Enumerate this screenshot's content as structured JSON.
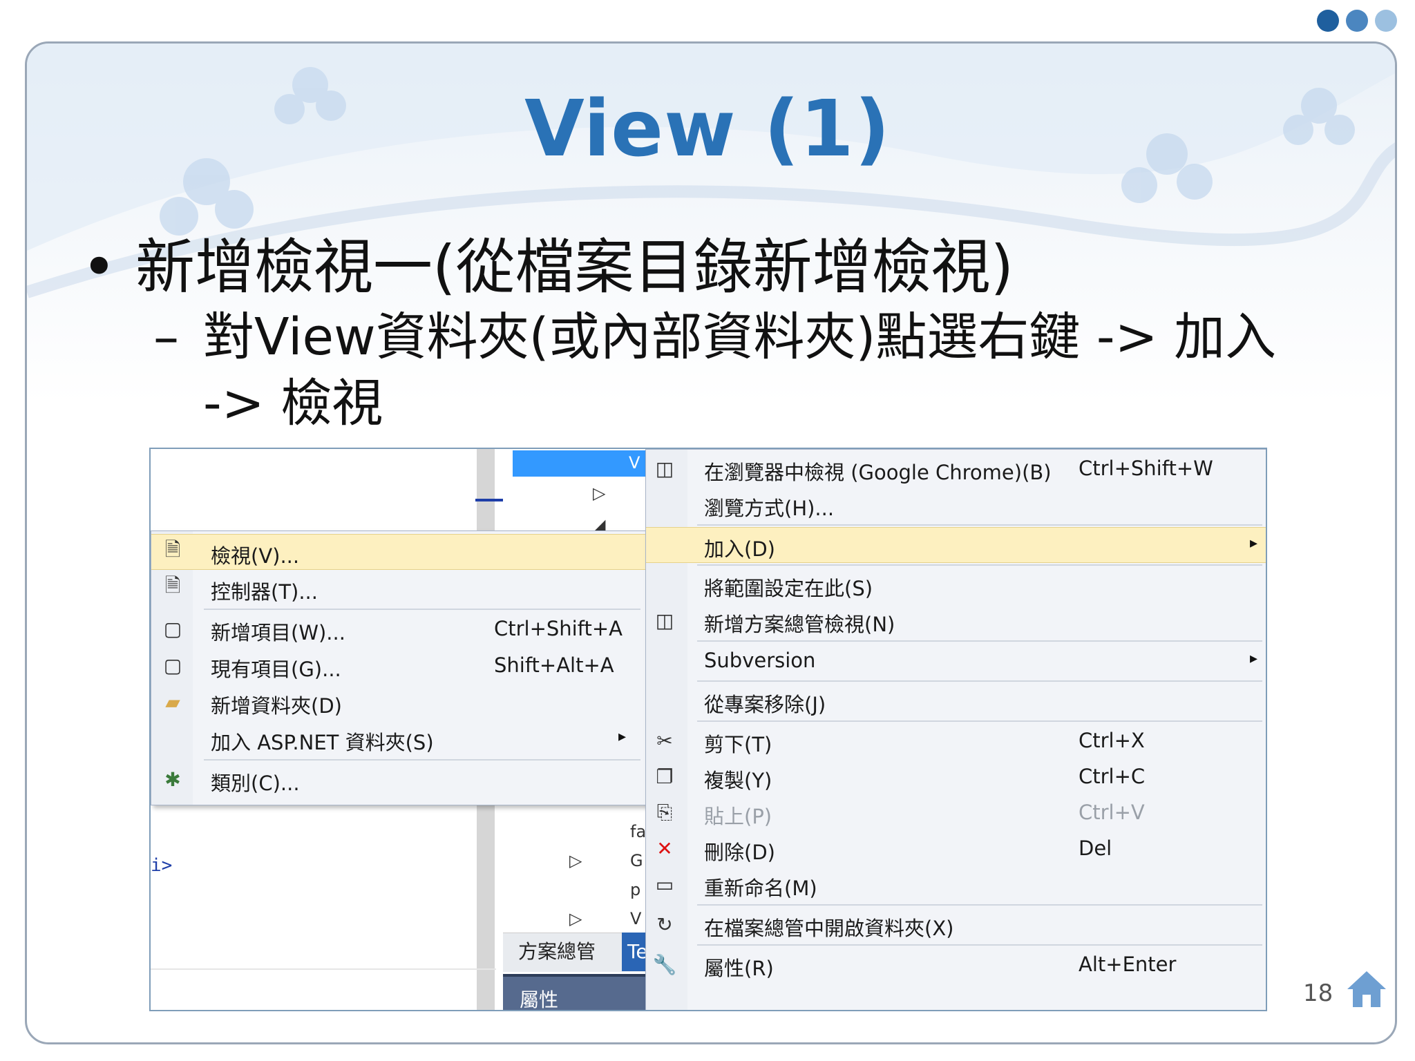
{
  "slide": {
    "title": "View (1)",
    "bullet1": {
      "marker": "•",
      "text": "新增檢視一(從檔案目錄新增檢視)"
    },
    "bullet2": {
      "marker": "–",
      "line1": "對View資料夾(或內部資料夾)點選右鍵 -> 加入",
      "line2": "-> 檢視"
    },
    "page_number": "18",
    "colors": {
      "title": "#2a72b6",
      "dot1": "#1f5f9e",
      "dot2": "#4b86c0",
      "dot3": "#9cc0e0",
      "highlight": "#fdf0c0"
    }
  },
  "screenshot": {
    "code_text": "i>",
    "solution_tab": "方案總管",
    "team_tab": "Te",
    "properties_label": "屬性",
    "tree_items": [
      "V",
      "fa",
      "G",
      "p",
      "V"
    ],
    "left_menu": [
      {
        "label": "檢視(V)...",
        "shortcut": "",
        "icon": "view-icon",
        "highlighted": true
      },
      {
        "label": "控制器(T)...",
        "shortcut": "",
        "icon": "controller-icon"
      },
      {
        "label": "新增項目(W)...",
        "shortcut": "Ctrl+Shift+A",
        "icon": "new-item-icon"
      },
      {
        "label": "現有項目(G)...",
        "shortcut": "Shift+Alt+A",
        "icon": "existing-item-icon"
      },
      {
        "label": "新增資料夾(D)",
        "shortcut": "",
        "icon": "new-folder-icon"
      },
      {
        "label": "加入 ASP.NET 資料夾(S)",
        "shortcut": "",
        "icon": "",
        "submenu": "▸"
      },
      {
        "label": "類別(C)...",
        "shortcut": "",
        "icon": "class-icon"
      }
    ],
    "right_menu": [
      {
        "label": "在瀏覽器中檢視 (Google Chrome)(B)",
        "shortcut": "Ctrl+Shift+W",
        "icon": "browser-icon"
      },
      {
        "label": "瀏覽方式(H)...",
        "shortcut": "",
        "icon": ""
      },
      {
        "label": "加入(D)",
        "shortcut": "",
        "icon": "",
        "highlighted": true,
        "submenu": "▸"
      },
      {
        "label": "將範圍設定在此(S)",
        "shortcut": "",
        "icon": ""
      },
      {
        "label": "新增方案總管檢視(N)",
        "shortcut": "",
        "icon": "new-explorer-view-icon"
      },
      {
        "label": "Subversion",
        "shortcut": "",
        "icon": "",
        "submenu": "▸"
      },
      {
        "label": "從專案移除(J)",
        "shortcut": "",
        "icon": ""
      },
      {
        "label": "剪下(T)",
        "shortcut": "Ctrl+X",
        "icon": "cut-icon"
      },
      {
        "label": "複製(Y)",
        "shortcut": "Ctrl+C",
        "icon": "copy-icon"
      },
      {
        "label": "貼上(P)",
        "shortcut": "Ctrl+V",
        "icon": "paste-icon",
        "disabled": true
      },
      {
        "label": "刪除(D)",
        "shortcut": "Del",
        "icon": "delete-icon"
      },
      {
        "label": "重新命名(M)",
        "shortcut": "",
        "icon": "rename-icon"
      },
      {
        "label": "在檔案總管中開啟資料夾(X)",
        "shortcut": "",
        "icon": "open-folder-icon"
      },
      {
        "label": "屬性(R)",
        "shortcut": "Alt+Enter",
        "icon": "properties-icon"
      }
    ]
  }
}
